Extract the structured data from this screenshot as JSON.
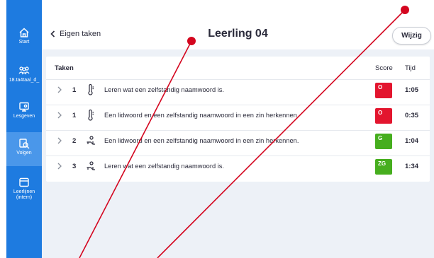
{
  "sidebar": {
    "items": [
      {
        "label": "Start",
        "icon": "home-icon"
      },
      {
        "label": "18.ta4taal_d_",
        "icon": "group-icon"
      },
      {
        "label": "Lesgeven",
        "icon": "teach-icon"
      },
      {
        "label": "Volgen",
        "icon": "track-icon",
        "active": true
      },
      {
        "label": "Leerlijnen\n(intern)",
        "icon": "learning-lines-icon"
      }
    ]
  },
  "header": {
    "back_label": "Eigen taken",
    "title": "Leerling 04",
    "edit_label": "Wijzig"
  },
  "table": {
    "headers": {
      "tasks": "Taken",
      "score": "Score",
      "time": "Tijd"
    },
    "rows": [
      {
        "number": "1",
        "type_icon": "thermometer-icon",
        "text": "Leren wat een zelfstandig naamwoord is.",
        "score": "O",
        "score_color": "#E3152E",
        "time": "1:05"
      },
      {
        "number": "1",
        "type_icon": "thermometer-icon",
        "text": "Een lidwoord en een zelfstandig naamwoord in een zin herkennen.",
        "score": "O",
        "score_color": "#E3152E",
        "time": "0:35"
      },
      {
        "number": "2",
        "type_icon": "practice-icon",
        "text": "Een lidwoord en een zelfstandig naamwoord in een zin herkennen.",
        "score": "G",
        "score_color": "#46AE1E",
        "time": "1:04"
      },
      {
        "number": "3",
        "type_icon": "practice-icon",
        "text": "Leren wat een zelfstandig naamwoord is.",
        "score": "ZG",
        "score_color": "#46AE1E",
        "time": "1:34"
      }
    ]
  },
  "colors": {
    "sidebar": "#1E7BE0",
    "sidebar_active": "#4A97EA",
    "content_bg": "#EDF1F7",
    "annotation": "#D4061F"
  }
}
